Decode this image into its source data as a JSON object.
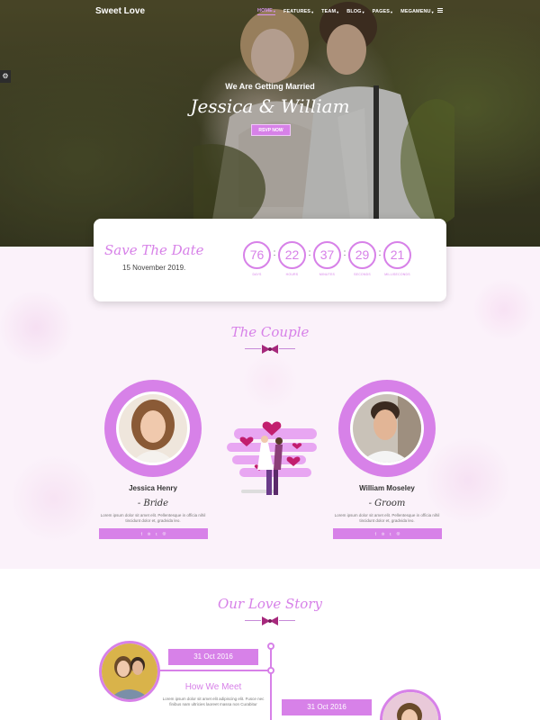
{
  "nav": {
    "brand": "Sweet Love",
    "items": [
      {
        "label": "HOME",
        "active": true
      },
      {
        "label": "FEATURES"
      },
      {
        "label": "TEAM"
      },
      {
        "label": "BLOG"
      },
      {
        "label": "PAGES"
      },
      {
        "label": "MEGAMENU"
      }
    ],
    "caret": "▾"
  },
  "settings_icon": "gear-icon",
  "hero": {
    "subtitle": "We Are Getting Married",
    "title": "Jessica & William",
    "rsvp_label": "RSVP NOW"
  },
  "save_the_date": {
    "title": "Save The Date",
    "date": "15 November 2019.",
    "countdown": [
      {
        "value": "76",
        "label": "DAYS"
      },
      {
        "value": "22",
        "label": "HOURS"
      },
      {
        "value": "37",
        "label": "MINUTES"
      },
      {
        "value": "29",
        "label": "SECONDS"
      },
      {
        "value": "21",
        "label": "MILLISECONDS"
      }
    ],
    "separator": ":"
  },
  "couple": {
    "title": "The Couple",
    "bride": {
      "name": "Jessica Henry",
      "role": "- Bride",
      "bio": "Lorem ipsum dolor sit amet elit. Pellentesque in officia nihil tincidunt dolor et, gradvida leo."
    },
    "groom": {
      "name": "William Moseley",
      "role": "- Groom",
      "bio": "Lorem ipsum dolor sit amet elit. Pellentesque in officia nihil tincidunt dolor et, gradvida leo."
    },
    "social_icons": [
      "f",
      "℗",
      "t",
      "◎"
    ]
  },
  "love_story": {
    "title": "Our Love Story",
    "events": [
      {
        "date": "31 Oct 2016",
        "heading": "How We Meet",
        "text": "Lorem ipsum dolor sit amet elit adipiscing elit. Fusce nec finibus nam ultricies laoreet massa non Curabitur"
      },
      {
        "date": "31 Oct 2016"
      }
    ]
  },
  "colors": {
    "accent": "#d781e8",
    "accent_light": "#f1c6fa",
    "bow": "#a6287c"
  }
}
